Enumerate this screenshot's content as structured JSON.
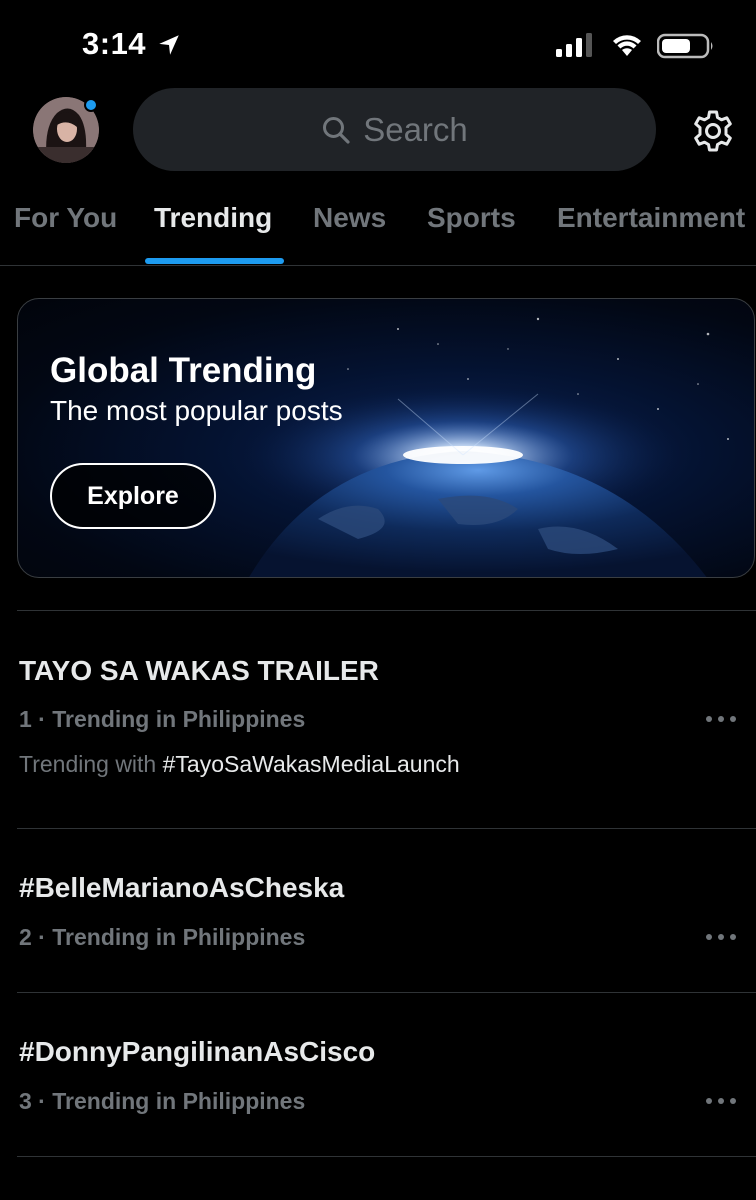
{
  "status_bar": {
    "time": "3:14",
    "icons": [
      "location-arrow-icon",
      "cellular-signal-icon",
      "wifi-icon",
      "battery-icon"
    ]
  },
  "header": {
    "avatar": "profile-avatar",
    "search_placeholder": "Search",
    "settings_icon": "gear-icon"
  },
  "tabs": [
    {
      "label": "For You",
      "active": false
    },
    {
      "label": "Trending",
      "active": true
    },
    {
      "label": "News",
      "active": false
    },
    {
      "label": "Sports",
      "active": false
    },
    {
      "label": "Entertainment",
      "active": false
    }
  ],
  "hero": {
    "title": "Global Trending",
    "subtitle": "The most popular posts",
    "button_label": "Explore"
  },
  "trends": [
    {
      "rank": "1",
      "title": "TAYO SA WAKAS TRAILER",
      "context": "Trending in Philippines",
      "with_prefix": "Trending with",
      "with_tag": "#TayoSaWakasMediaLaunch"
    },
    {
      "rank": "2",
      "title": "#BelleMarianoAsCheska",
      "context": "Trending in Philippines"
    },
    {
      "rank": "3",
      "title": "#DonnyPangilinanAsCisco",
      "context": "Trending in Philippines"
    }
  ],
  "colors": {
    "accent": "#1d9bf0",
    "background": "#000000",
    "secondary_text": "#71767b",
    "search_bg": "#202327"
  }
}
